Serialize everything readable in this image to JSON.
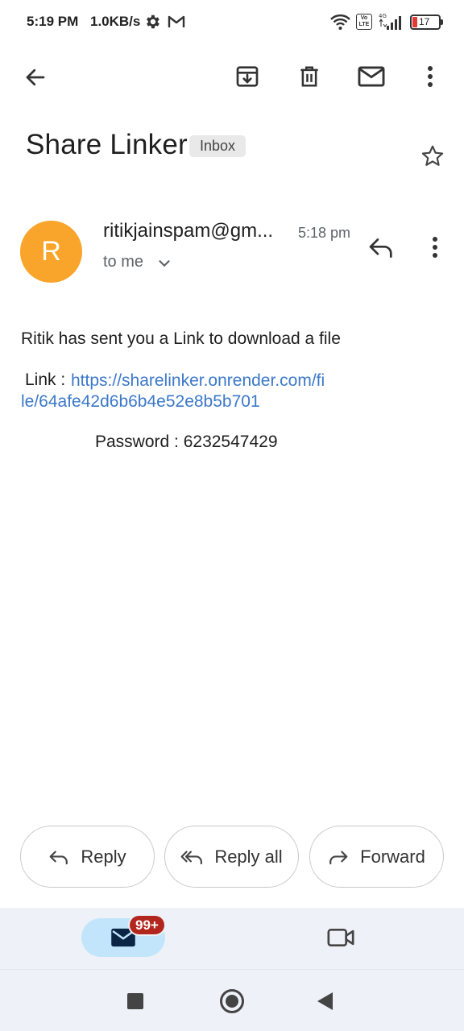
{
  "status_bar": {
    "time": "5:19 PM",
    "speed": "1.0KB/s",
    "network": "4G",
    "volte": "Vo LTE",
    "battery": "17",
    "battery_level": 0.17,
    "icons": [
      "gear-icon",
      "gmail-icon",
      "wifi-icon",
      "volte-icon",
      "signal-icon",
      "battery-icon"
    ]
  },
  "toolbar": {
    "icons": [
      "back-arrow-icon",
      "archive-icon",
      "delete-icon",
      "mark-unread-icon",
      "more-vert-icon"
    ]
  },
  "email": {
    "subject": "Share Linker",
    "label": "Inbox",
    "sender": "ritikjainspam@gm...",
    "time": "5:18 pm",
    "recipient": "to me",
    "avatar_letter": "R",
    "avatar_color": "#f9a42a",
    "body": {
      "line1": "Ritik has sent you a Link to download a file",
      "link_label": "Link :",
      "link_url": "https://sharelinker.onrender.com/file/64afe42d6b6b4e52e8b5b701",
      "password": "Password : 6232547429"
    }
  },
  "actions": {
    "reply": "Reply",
    "reply_all": "Reply all",
    "forward": "Forward"
  },
  "bottom_nav": {
    "mail_badge": "99+",
    "icons": [
      "mail-icon",
      "video-call-icon"
    ]
  },
  "colors": {
    "link": "#3b78c9",
    "accent_pill": "#c2e5fb",
    "badge": "#b3261e"
  }
}
